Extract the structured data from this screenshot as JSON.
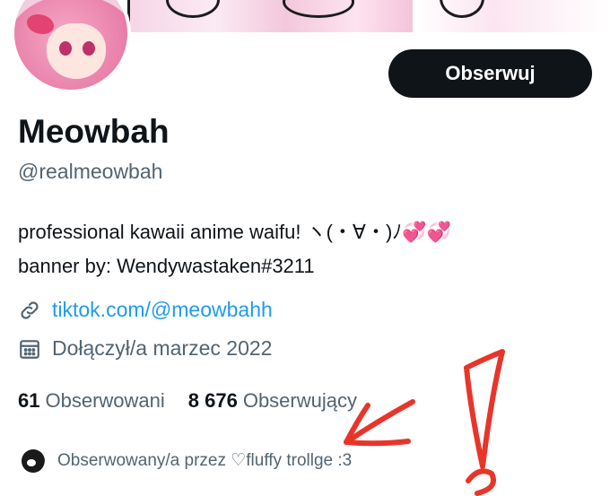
{
  "profile": {
    "display_name": "Meowbah",
    "handle": "@realmeowbah",
    "bio_line1": "professional kawaii anime waifu! ヽ(・∀・)ﾉ💞💞",
    "bio_line2": "banner by: Wendywastaken#3211",
    "link": "tiktok.com/@meowbahh",
    "joined": "Dołączył/a marzec 2022"
  },
  "actions": {
    "follow_label": "Obserwuj"
  },
  "stats": {
    "following_count": "61",
    "following_label": "Obserwowani",
    "followers_count": "8 676",
    "followers_label": "Obserwujący"
  },
  "followed_by": {
    "text": "Obserwowany/a przez ♡fluffy trollge :3"
  },
  "icons": [
    "link-icon",
    "calendar-icon"
  ],
  "colors": {
    "accent": "#1d9bf0",
    "muted": "#536471",
    "annotation": "#e8352a"
  }
}
